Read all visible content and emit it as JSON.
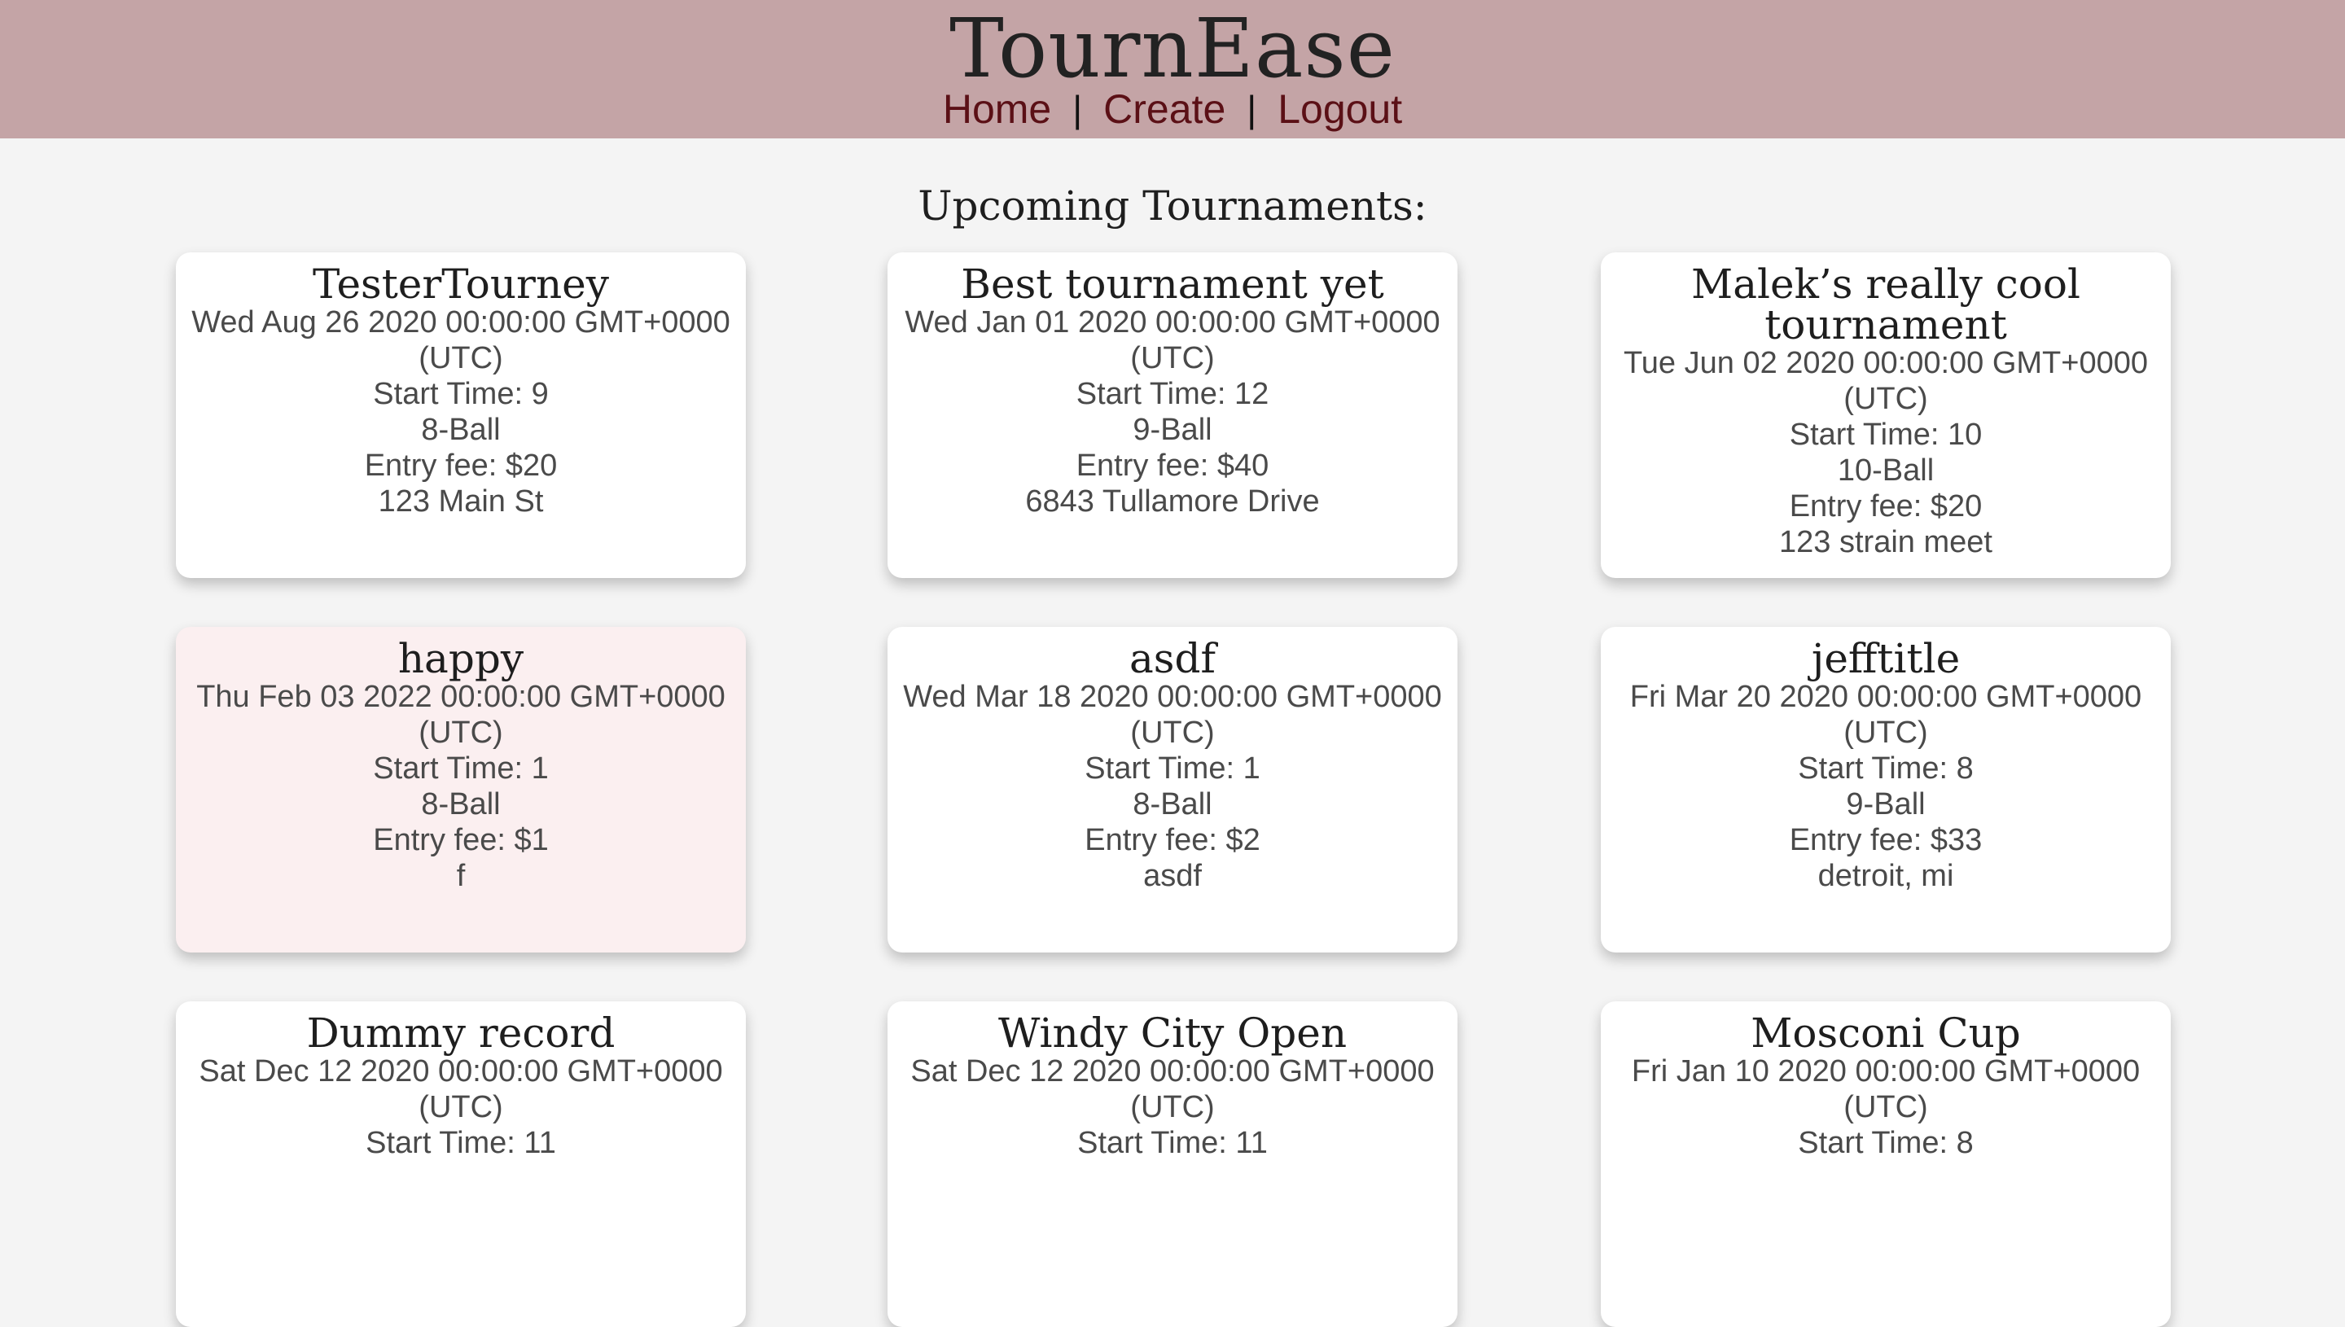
{
  "header": {
    "brand": "TournEase",
    "nav": {
      "home": "Home",
      "create": "Create",
      "logout": "Logout",
      "separator": "|"
    },
    "colors": {
      "header_bg": "#c4a4a6",
      "nav_link": "#5b1016",
      "page_bg": "#f4f4f4"
    }
  },
  "main": {
    "section_title": "Upcoming Tournaments:",
    "tournaments": [
      {
        "name": "TesterTourney",
        "date": "Wed Aug 26 2020 00:00:00 GMT+0000 (UTC)",
        "start_time": "Start Time: 9",
        "game": "8-Ball",
        "entry_fee": "Entry fee: $20",
        "location": "123 Main St"
      },
      {
        "name": "Best tournament yet",
        "date": "Wed Jan 01 2020 00:00:00 GMT+0000 (UTC)",
        "start_time": "Start Time: 12",
        "game": "9-Ball",
        "entry_fee": "Entry fee: $40",
        "location": "6843 Tullamore Drive"
      },
      {
        "name": "Malek’s really cool tournament",
        "date": "Tue Jun 02 2020 00:00:00 GMT+0000 (UTC)",
        "start_time": "Start Time: 10",
        "game": "10-Ball",
        "entry_fee": "Entry fee: $20",
        "location": "123 strain meet"
      },
      {
        "name": "happy",
        "date": "Thu Feb 03 2022 00:00:00 GMT+0000 (UTC)",
        "start_time": "Start Time: 1",
        "game": "8-Ball",
        "entry_fee": "Entry fee: $1",
        "location": "f"
      },
      {
        "name": "asdf",
        "date": "Wed Mar 18 2020 00:00:00 GMT+0000 (UTC)",
        "start_time": "Start Time: 1",
        "game": "8-Ball",
        "entry_fee": "Entry fee: $2",
        "location": "asdf"
      },
      {
        "name": "jefftitle",
        "date": "Fri Mar 20 2020 00:00:00 GMT+0000 (UTC)",
        "start_time": "Start Time: 8",
        "game": "9-Ball",
        "entry_fee": "Entry fee: $33",
        "location": "detroit, mi"
      },
      {
        "name": "Dummy record",
        "date": "Sat Dec 12 2020 00:00:00 GMT+0000 (UTC)",
        "start_time": "Start Time: 11"
      },
      {
        "name": "Windy City Open",
        "date": "Sat Dec 12 2020 00:00:00 GMT+0000 (UTC)",
        "start_time": "Start Time: 11"
      },
      {
        "name": "Mosconi Cup",
        "date": "Fri Jan 10 2020 00:00:00 GMT+0000 (UTC)",
        "start_time": "Start Time: 8"
      }
    ]
  }
}
